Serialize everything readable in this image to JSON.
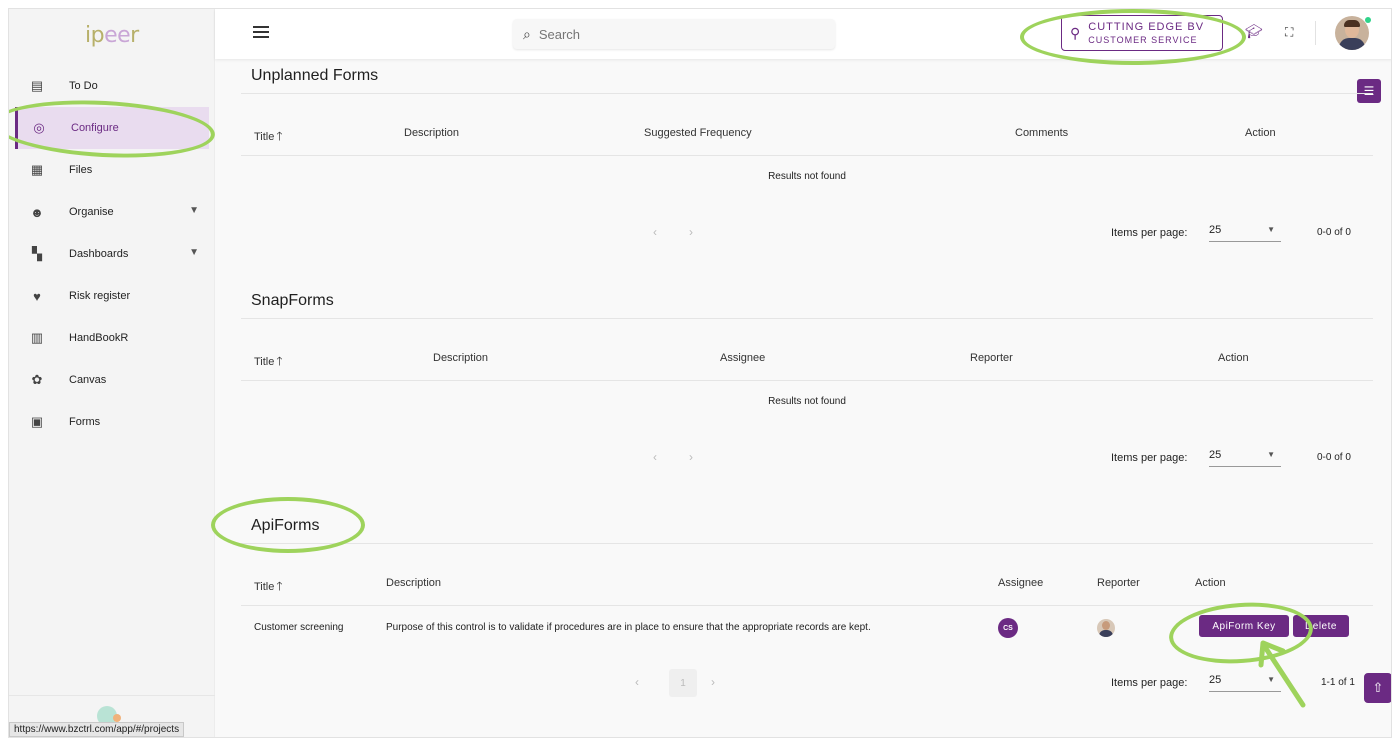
{
  "app": {
    "logo_text_a": "ip",
    "logo_text_b": "ee",
    "logo_text_c": "r"
  },
  "header": {
    "search_placeholder": "Search",
    "org_name": "CUTTING EDGE BV",
    "org_unit": "CUSTOMER SERVICE"
  },
  "sidebar": {
    "items": [
      {
        "label": "To Do",
        "icon": "clipboard-icon"
      },
      {
        "label": "Configure",
        "icon": "target-icon"
      },
      {
        "label": "Files",
        "icon": "files-icon"
      },
      {
        "label": "Organise",
        "icon": "people-icon"
      },
      {
        "label": "Dashboards",
        "icon": "dashboard-icon"
      },
      {
        "label": "Risk register",
        "icon": "heart-icon"
      },
      {
        "label": "HandBookR",
        "icon": "books-icon"
      },
      {
        "label": "Canvas",
        "icon": "palette-icon"
      },
      {
        "label": "Forms",
        "icon": "forms-icon"
      }
    ],
    "status_url": "https://www.bzctrl.com/app/#/projects"
  },
  "unplanned": {
    "title": "Unplanned Forms",
    "columns": [
      "Title",
      "Description",
      "Suggested Frequency",
      "Comments",
      "Action"
    ],
    "empty": "Results not found",
    "ipp_label": "Items per page:",
    "ipp_value": "25",
    "range": "0-0 of 0"
  },
  "snap": {
    "title": "SnapForms",
    "columns": [
      "Title",
      "Description",
      "Assignee",
      "Reporter",
      "Action"
    ],
    "empty": "Results not found",
    "ipp_label": "Items per page:",
    "ipp_value": "25",
    "range": "0-0 of 0"
  },
  "api": {
    "title": "ApiForms",
    "columns": [
      "Title",
      "Description",
      "Assignee",
      "Reporter",
      "Action"
    ],
    "rows": [
      {
        "title": "Customer screening",
        "description": "Purpose of this control is to validate if procedures are in place to ensure that the appropriate records are kept.",
        "assignee_initials": "CS",
        "apiform_key_label": "ApiForm Key",
        "delete_label": "Delete"
      }
    ],
    "page": "1",
    "ipp_label": "Items per page:",
    "ipp_value": "25",
    "range": "1-1 of 1"
  },
  "colors": {
    "accent": "#6b2a83",
    "annotation": "#9ed35c"
  }
}
